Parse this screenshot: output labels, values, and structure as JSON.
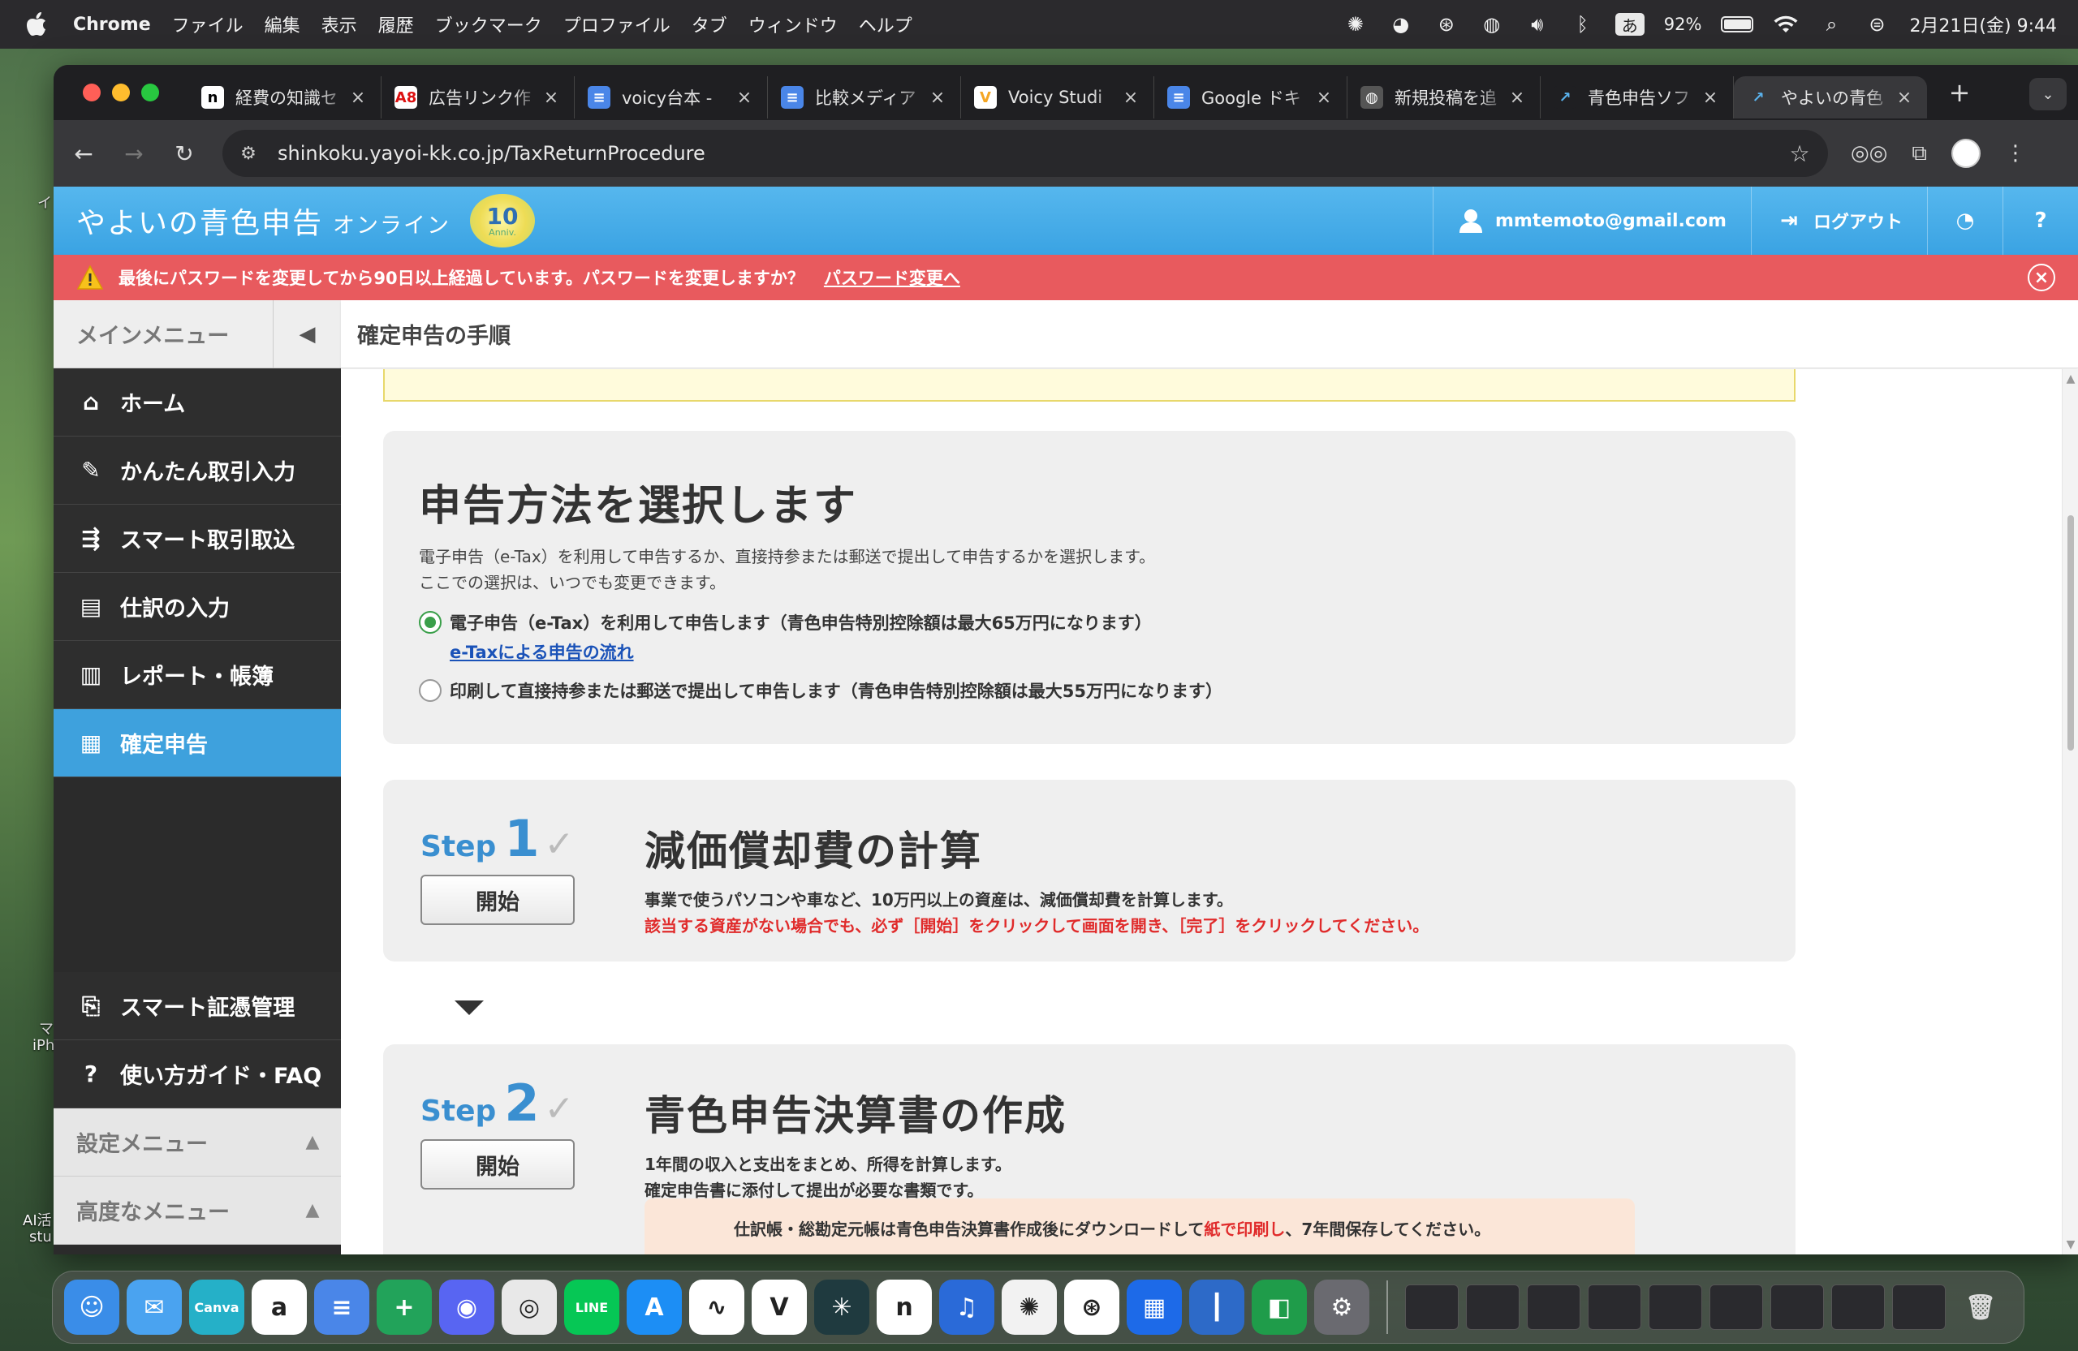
{
  "menubar": {
    "app_name": "Chrome",
    "menus": [
      "ファイル",
      "編集",
      "表示",
      "履歴",
      "ブックマーク",
      "プロファイル",
      "タブ",
      "ウィンドウ",
      "ヘルプ"
    ],
    "ime": "あ",
    "battery_pct": "92%",
    "battery_level": 0.92,
    "datetime": "2月21日(金) 9:44"
  },
  "desktop": {
    "label1": "イ",
    "label2": "マ",
    "label3": "iPh",
    "label4": "AI活",
    "label5": "stu"
  },
  "tabs": [
    {
      "title": "経費の知識セ",
      "favicon": "n",
      "color": "#ffffff",
      "fg": "#000000"
    },
    {
      "title": "広告リンク作",
      "favicon": "A8",
      "color": "#ffffff",
      "fg": "#d11"
    },
    {
      "title": "voicy台本 -",
      "favicon": "≡",
      "color": "#4a86e8",
      "fg": "#ffffff"
    },
    {
      "title": "比較メディア",
      "favicon": "≡",
      "color": "#4a86e8",
      "fg": "#ffffff"
    },
    {
      "title": "Voicy Studi",
      "favicon": "V",
      "color": "#ffffff",
      "fg": "#f5a623"
    },
    {
      "title": "Google ドキ",
      "favicon": "≡",
      "color": "#4a86e8",
      "fg": "#ffffff"
    },
    {
      "title": "新規投稿を追",
      "favicon": "◍",
      "color": "#555555",
      "fg": "#ffffff"
    },
    {
      "title": "青色申告ソフ",
      "favicon": "↗",
      "color": "#1f1f22",
      "fg": "#5ab3ee"
    },
    {
      "title": "やよいの青色",
      "favicon": "↗",
      "color": "#38383b",
      "fg": "#5ab3ee"
    }
  ],
  "active_tab_index": 8,
  "omnibox": {
    "url": "shinkoku.yayoi-kk.co.jp/TaxReturnProcedure"
  },
  "header": {
    "logo_main": "やよいの青色申告",
    "logo_sub": "オンライン",
    "anniv_num": "10",
    "anniv_text": "Anniv.",
    "user_email": "mmtemoto@gmail.com",
    "logout": "ログアウト"
  },
  "alert": {
    "message": "最後にパスワードを変更してから90日以上経過しています。パスワードを変更しますか？",
    "link": "パスワード変更へ"
  },
  "sidebar": {
    "main_menu": "メインメニュー",
    "items": [
      {
        "label": "ホーム",
        "icon": "home-icon",
        "glyph": "⌂"
      },
      {
        "label": "かんたん取引入力",
        "icon": "pencil-icon",
        "glyph": "✎"
      },
      {
        "label": "スマート取引取込",
        "icon": "import-icon",
        "glyph": "⇶"
      },
      {
        "label": "仕訳の入力",
        "icon": "ledger-icon",
        "glyph": "▤"
      },
      {
        "label": "レポート・帳簿",
        "icon": "chart-icon",
        "glyph": "▥"
      },
      {
        "label": "確定申告",
        "icon": "tax-return-icon",
        "glyph": "▦"
      }
    ],
    "active_index": 5,
    "bottom_items": [
      {
        "label": "スマート証憑管理",
        "icon": "receipt-icon",
        "glyph": "⎘"
      },
      {
        "label": "使い方ガイド・FAQ",
        "icon": "help-circle-icon",
        "glyph": "?"
      }
    ],
    "settings_menu": "設定メニュー",
    "advanced_menu": "高度なメニュー"
  },
  "content": {
    "title": "確定申告の手順",
    "method": {
      "heading": "申告方法を選択します",
      "desc1": "電子申告（e-Tax）を利用して申告するか、直接持参または郵送で提出して申告するかを選択します。",
      "desc2": "ここでの選択は、いつでも変更できます。",
      "option1": "電子申告（e-Tax）を利用して申告します（青色申告特別控除額は最大65万円になります）",
      "option1_link": "e-Taxによる申告の流れ",
      "option2": "印刷して直接持参または郵送で提出して申告します（青色申告特別控除額は最大55万円になります）",
      "selected": 1
    },
    "steps": [
      {
        "word": "Step",
        "num": "1",
        "button": "開始",
        "title": "減価償却費の計算",
        "desc": "事業で使うパソコンや車など、10万円以上の資産は、減価償却費を計算します。",
        "warn": "該当する資産がない場合でも、必ず［開始］をクリックして画面を開き、［完了］をクリックしてください。"
      },
      {
        "word": "Step",
        "num": "2",
        "button": "開始",
        "title": "青色申告決算書の作成",
        "desc1": "1年間の収入と支出をまとめ、所得を計算します。",
        "desc2": "確定申告書に添付して提出が必要な書類です。",
        "note_pre": "仕訳帳・総勘定元帳は青色申告決算書作成後にダウンロードして",
        "note_red": "紙で印刷し",
        "note_post": "、7年間保存してください。"
      }
    ]
  },
  "dock": {
    "apps": [
      {
        "name": "finder-app",
        "color": "#3a8de8",
        "glyph": "☺"
      },
      {
        "name": "mail-app",
        "color": "#4aa3f0",
        "glyph": "✉"
      },
      {
        "name": "canva-app",
        "color": "#25b0c8",
        "glyph": "Canva"
      },
      {
        "name": "amazon-app",
        "color": "#ffffff",
        "glyph": "a"
      },
      {
        "name": "docs-app",
        "color": "#4a86e8",
        "glyph": "≡"
      },
      {
        "name": "sheets-app",
        "color": "#22a35a",
        "glyph": "+"
      },
      {
        "name": "discord-app",
        "color": "#5865f2",
        "glyph": "◉"
      },
      {
        "name": "chrome-app",
        "color": "#e8e8e8",
        "glyph": "◎"
      },
      {
        "name": "line-app",
        "color": "#06c755",
        "glyph": "LINE"
      },
      {
        "name": "appstore-app",
        "color": "#1c8ef5",
        "glyph": "A"
      },
      {
        "name": "voice-app",
        "color": "#ffffff",
        "glyph": "∿"
      },
      {
        "name": "voicy-app",
        "color": "#ffffff",
        "glyph": "V"
      },
      {
        "name": "perplexity-app",
        "color": "#1f3a3f",
        "glyph": "✳"
      },
      {
        "name": "notion-app",
        "color": "#ffffff",
        "glyph": "n"
      },
      {
        "name": "audible-app",
        "color": "#2a6ad8",
        "glyph": "♫"
      },
      {
        "name": "claude-app",
        "color": "#f2f2f2",
        "glyph": "✺"
      },
      {
        "name": "chatgpt-app",
        "color": "#ffffff",
        "glyph": "⊛"
      },
      {
        "name": "trello-app",
        "color": "#1d6ae8",
        "glyph": "▦"
      },
      {
        "name": "voice-memo-app",
        "color": "#2d6ac8",
        "glyph": "┃"
      },
      {
        "name": "classroom-app",
        "color": "#1f9c4a",
        "glyph": "◧"
      },
      {
        "name": "settings-app",
        "color": "#6a6a70",
        "glyph": "⚙"
      }
    ],
    "windows": 9
  }
}
